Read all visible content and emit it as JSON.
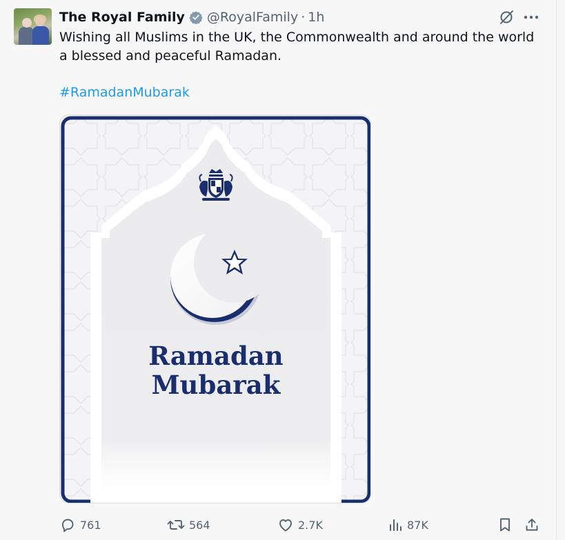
{
  "tweet": {
    "author_name": "The Royal Family",
    "handle": "@RoyalFamily",
    "separator": "·",
    "time": "1h",
    "text": "Wishing all Muslims in the UK, the Commonwealth and around the world a blessed and peaceful Ramadan.",
    "hashtag": "#RamadanMubarak"
  },
  "media": {
    "line1": "Ramadan",
    "line2": "Mubarak"
  },
  "actions": {
    "replies": "761",
    "reposts": "564",
    "likes": "2.7K",
    "views": "87K"
  },
  "icons": {
    "verified": "verified-badge-icon",
    "grok": "grok-icon",
    "more": "more-icon",
    "reply": "reply-icon",
    "repost": "repost-icon",
    "like": "heart-icon",
    "views": "views-icon",
    "bookmark": "bookmark-icon",
    "share": "share-icon"
  },
  "colors": {
    "navy": "#1a2e6e",
    "link": "#1d9bf0",
    "muted": "#536471"
  }
}
